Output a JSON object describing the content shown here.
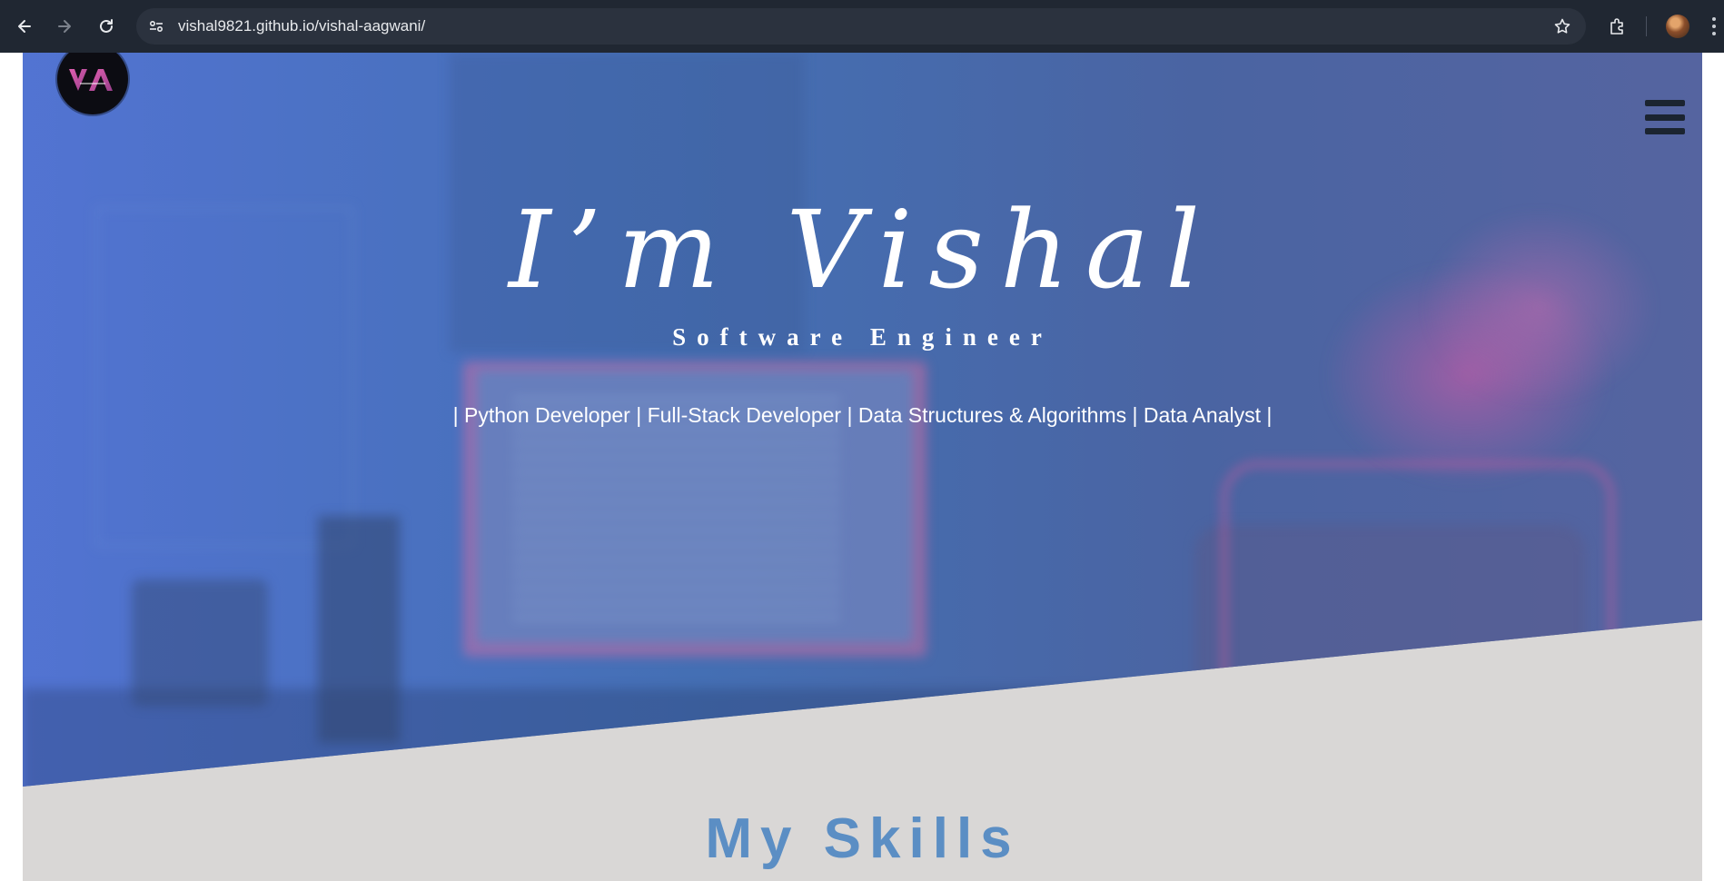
{
  "browser": {
    "url": "vishal9821.github.io/vishal-aagwani/",
    "icons": [
      "back-arrow-icon",
      "forward-arrow-icon",
      "reload-icon",
      "site-info-icon",
      "bookmark-star-icon",
      "extensions-icon",
      "profile-avatar",
      "more-menu-icon"
    ]
  },
  "header": {
    "logo_text": "VA",
    "menu_icon": "hamburger-icon"
  },
  "hero": {
    "title": "I’m Vishal",
    "subtitle": "Software Engineer",
    "roles": "| Python Developer | Full-Stack Developer | Data Structures & Algorithms | Data Analyst |"
  },
  "skills": {
    "heading": "My Skills"
  },
  "colors": {
    "chrome_bg": "#202732",
    "hero_overlay": "#4a78c8",
    "section_bg": "#d9d7d6",
    "skills_heading": "#5b8ec4",
    "logo_accent": "#d4549a"
  }
}
